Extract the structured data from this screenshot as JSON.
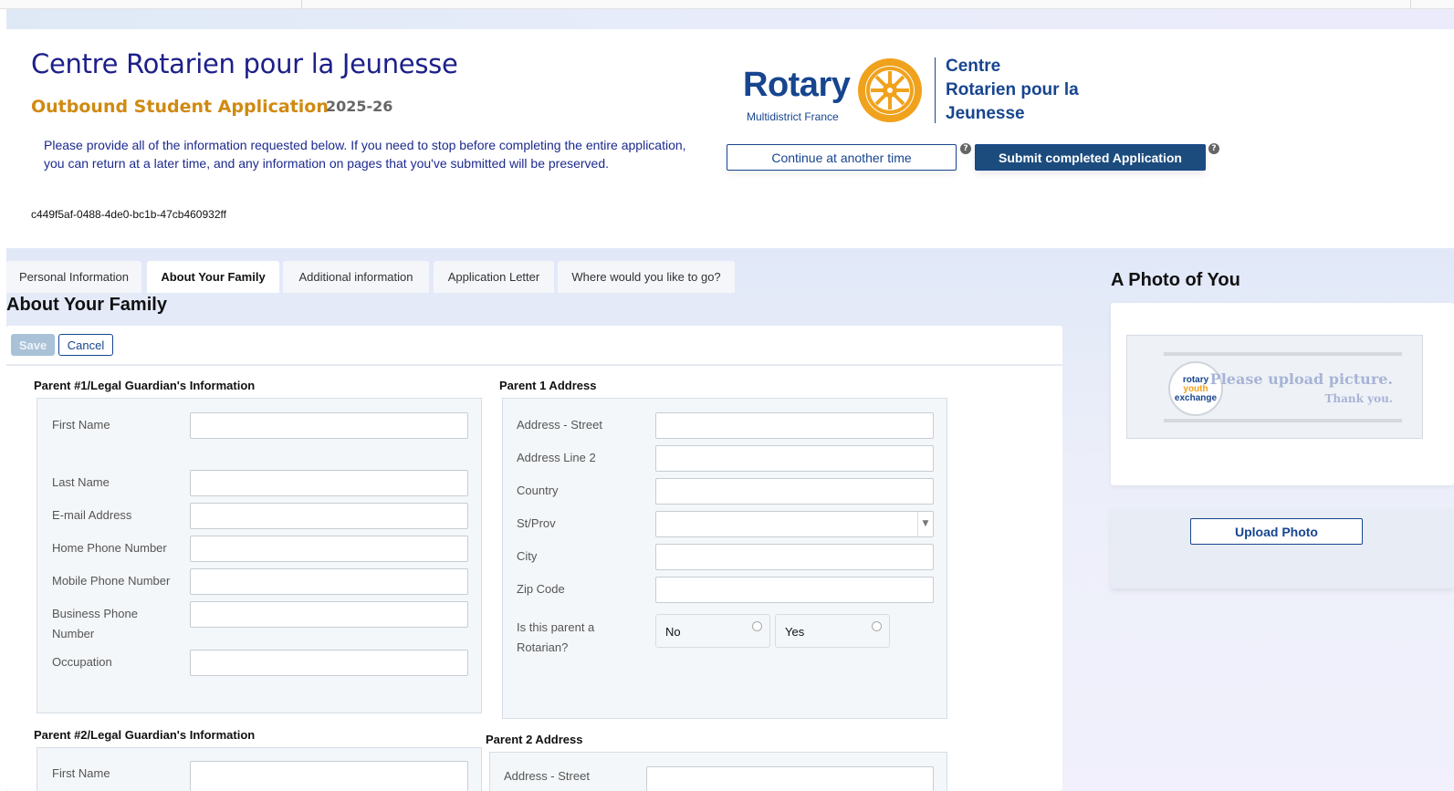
{
  "header": {
    "site_title": "Centre Rotarien pour la Jeunesse",
    "app_title": "Outbound Student Application",
    "app_year": "2025-26",
    "intro": "Please provide all of the information requested below. If you need to stop before completing the entire application, you can return at a later time, and any information on pages that you've submitted will be preserved.",
    "application_id": "c449f5af-0488-4de0-bc1b-47cb460932ff",
    "continue_label": "Continue at another time",
    "submit_label": "Submit completed Application",
    "help_glyph": "?"
  },
  "logo": {
    "rotary": "Rotary",
    "subtitle": "Multidistrict France",
    "right_line1": "Centre",
    "right_line2": "Rotarien pour la",
    "right_line3": "Jeunesse",
    "brand_color": "#17458f",
    "gold_color": "#f0a21d"
  },
  "tabs": [
    {
      "label": "Personal Information",
      "active": false
    },
    {
      "label": "About Your Family",
      "active": true
    },
    {
      "label": "Additional information",
      "active": false
    },
    {
      "label": "Application Letter",
      "active": false
    },
    {
      "label": "Where would you like to go?",
      "active": false
    }
  ],
  "section": {
    "title": "About Your Family",
    "save_label": "Save",
    "cancel_label": "Cancel"
  },
  "parent1": {
    "title": "Parent #1/Legal Guardian's Information",
    "fields": {
      "first_name": {
        "label": "First Name",
        "value": ""
      },
      "last_name": {
        "label": "Last Name",
        "value": ""
      },
      "email": {
        "label": "E-mail Address",
        "value": ""
      },
      "home_phone": {
        "label": "Home Phone Number",
        "value": ""
      },
      "mobile_phone": {
        "label": "Mobile Phone Number",
        "value": ""
      },
      "business_phone": {
        "label": "Business Phone Number",
        "value": ""
      },
      "occupation": {
        "label": "Occupation",
        "value": ""
      }
    }
  },
  "parent1_address": {
    "title": "Parent 1 Address",
    "fields": {
      "street": {
        "label": "Address - Street",
        "value": ""
      },
      "line2": {
        "label": "Address Line 2",
        "value": ""
      },
      "country": {
        "label": "Country",
        "value": ""
      },
      "st_prov": {
        "label": "St/Prov",
        "value": ""
      },
      "city": {
        "label": "City",
        "value": ""
      },
      "zip": {
        "label": "Zip Code",
        "value": ""
      },
      "rotarian": {
        "label": "Is this parent a Rotarian?",
        "options": [
          "No",
          "Yes"
        ],
        "selected": null
      }
    }
  },
  "parent2": {
    "title": "Parent #2/Legal Guardian's Information",
    "first_name_label": "First Name"
  },
  "parent2_address": {
    "title": "Parent 2 Address",
    "street_label": "Address - Street"
  },
  "photo": {
    "title": "A Photo of You",
    "placeholder_line1": "Please upload picture.",
    "placeholder_line2": "Thank you.",
    "badge_line1": "rotary",
    "badge_line2": "youth",
    "badge_line3": "exchange",
    "upload_label": "Upload Photo"
  }
}
